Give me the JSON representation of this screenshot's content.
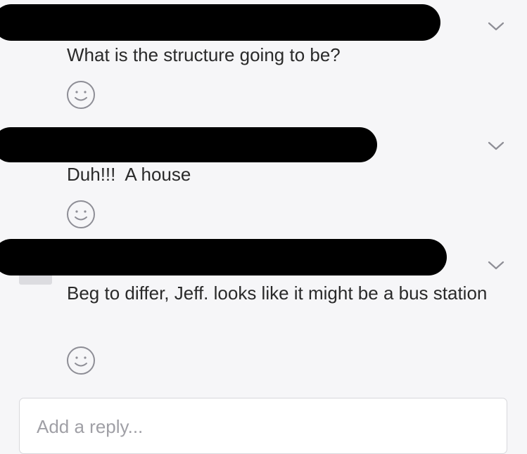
{
  "comments": [
    {
      "author": "",
      "text": "What is the structure going to be?",
      "menu_icon": "chevron-down-icon",
      "reaction_icon": "smiley-icon"
    },
    {
      "author": "",
      "text": "Duh!!!  A house",
      "menu_icon": "chevron-down-icon",
      "reaction_icon": "smiley-icon"
    },
    {
      "author": "",
      "text": "Beg to differ, Jeff. looks like it might be a bus station",
      "menu_icon": "chevron-down-icon",
      "reaction_icon": "smiley-icon"
    }
  ],
  "reply": {
    "placeholder": "Add a reply...",
    "value": ""
  },
  "colors": {
    "background": "#f6f6f8",
    "text": "#2a2a2a",
    "icon": "#8e8e96",
    "redaction": "#000000",
    "placeholder": "#a0a0a6"
  }
}
